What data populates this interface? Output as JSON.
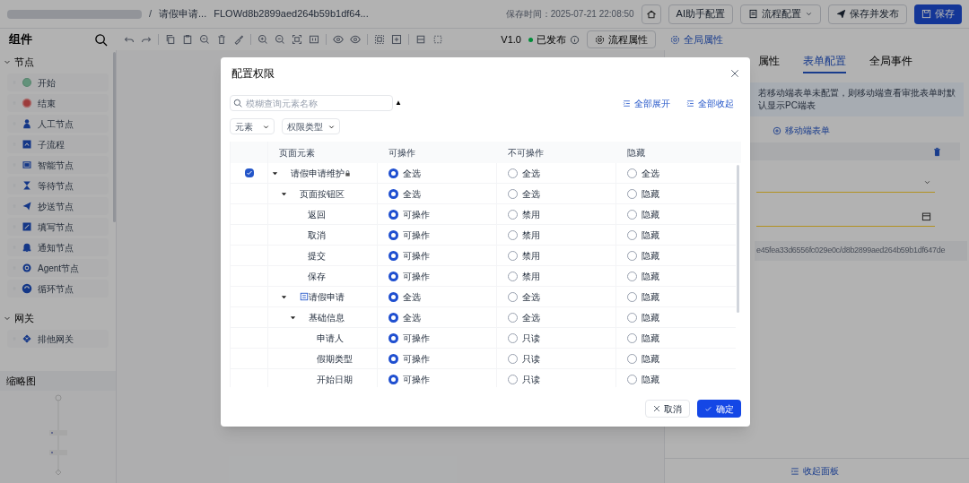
{
  "top_bar": {
    "breadcrumb_separator": "/",
    "process_name": "请假申请...",
    "flow_id": "FLOWd8b2899aed264b59b1df64...",
    "save_time": "保存时间：2025-07-21 22:08:50",
    "buttons": [
      {
        "label": "AI助手配置",
        "kind": "plain"
      },
      {
        "label": "流程配置",
        "kind": "dropdown"
      },
      {
        "label": "保存并发布",
        "kind": "send"
      },
      {
        "label": "保存",
        "kind": "primary"
      }
    ]
  },
  "toolbar": {
    "title": "组件",
    "version": "V1.0",
    "status": "已发布",
    "process_props": "流程属性",
    "global_props": "全局属性"
  },
  "sidebar": {
    "sections": [
      {
        "title": "节点",
        "expanded": true,
        "items": [
          "开始",
          "结束",
          "人工节点",
          "子流程",
          "智能节点",
          "等待节点",
          "抄送节点",
          "填写节点",
          "通知节点",
          "Agent节点",
          "循环节点"
        ]
      },
      {
        "title": "网关",
        "expanded": true,
        "items": [
          "排他网关"
        ]
      }
    ],
    "minimap_title": "缩略图"
  },
  "right_panel": {
    "tabs": [
      {
        "label": "属性",
        "selected": false
      },
      {
        "label": "表单配置",
        "selected": true
      },
      {
        "label": "全局事件",
        "selected": false
      }
    ],
    "notice": "若移动端表单未配置，则移动端查看审批表单时默认显示PC端表",
    "add_link": "移动端表单",
    "url": "e45fea33d6556fc029e0c/d8b2899aed264b59b1df647de",
    "collapse": "收起面板"
  },
  "dialog": {
    "title": "配置权限",
    "search": {
      "placeholder": "模糊查询元素名称"
    },
    "sort_mark": "▲",
    "expand_all": "全部展开",
    "collapse_all": "全部收起",
    "filters": [
      "元素",
      "权限类型"
    ],
    "columns": [
      "页面元素",
      "可操作",
      "不可操作",
      "隐藏"
    ],
    "rows": [
      {
        "name": "请假申请维护",
        "kind": "page",
        "checked": true,
        "expanded": true,
        "options": [
          {
            "label": "全选",
            "selected": true
          },
          {
            "label": "全选",
            "selected": false
          },
          {
            "label": "全选",
            "selected": false
          }
        ],
        "children": [
          {
            "name": "页面按钮区",
            "kind": "group",
            "expanded": true,
            "options": [
              {
                "label": "全选",
                "selected": true
              },
              {
                "label": "全选",
                "selected": false
              },
              {
                "label": "隐藏",
                "selected": false
              }
            ],
            "children": [
              {
                "name": "返回",
                "kind": "item",
                "options": [
                  {
                    "label": "可操作",
                    "selected": true
                  },
                  {
                    "label": "禁用",
                    "selected": false
                  },
                  {
                    "label": "隐藏",
                    "selected": false
                  }
                ]
              },
              {
                "name": "取消",
                "kind": "item",
                "options": [
                  {
                    "label": "可操作",
                    "selected": true
                  },
                  {
                    "label": "禁用",
                    "selected": false
                  },
                  {
                    "label": "隐藏",
                    "selected": false
                  }
                ]
              },
              {
                "name": "提交",
                "kind": "item",
                "options": [
                  {
                    "label": "可操作",
                    "selected": true
                  },
                  {
                    "label": "禁用",
                    "selected": false
                  },
                  {
                    "label": "隐藏",
                    "selected": false
                  }
                ]
              },
              {
                "name": "保存",
                "kind": "item",
                "options": [
                  {
                    "label": "可操作",
                    "selected": true
                  },
                  {
                    "label": "禁用",
                    "selected": false
                  },
                  {
                    "label": "隐藏",
                    "selected": false
                  }
                ]
              }
            ]
          },
          {
            "name": "请假申请",
            "kind": "form",
            "expanded": true,
            "options": [
              {
                "label": "全选",
                "selected": true
              },
              {
                "label": "全选",
                "selected": false
              },
              {
                "label": "隐藏",
                "selected": false
              }
            ],
            "children": [
              {
                "name": "基础信息",
                "kind": "group",
                "expanded": true,
                "options": [
                  {
                    "label": "全选",
                    "selected": true
                  },
                  {
                    "label": "全选",
                    "selected": false
                  },
                  {
                    "label": "隐藏",
                    "selected": false
                  }
                ],
                "children": [
                  {
                    "name": "申请人",
                    "kind": "item",
                    "options": [
                      {
                        "label": "可操作",
                        "selected": true
                      },
                      {
                        "label": "只读",
                        "selected": false
                      },
                      {
                        "label": "隐藏",
                        "selected": false
                      }
                    ]
                  },
                  {
                    "name": "假期类型",
                    "kind": "item",
                    "options": [
                      {
                        "label": "可操作",
                        "selected": true
                      },
                      {
                        "label": "只读",
                        "selected": false
                      },
                      {
                        "label": "隐藏",
                        "selected": false
                      }
                    ]
                  },
                  {
                    "name": "开始日期",
                    "kind": "item",
                    "options": [
                      {
                        "label": "可操作",
                        "selected": true
                      },
                      {
                        "label": "只读",
                        "selected": false
                      },
                      {
                        "label": "隐藏",
                        "selected": false
                      }
                    ]
                  }
                ]
              }
            ]
          }
        ]
      }
    ],
    "buttons": [
      {
        "label": "取消",
        "kind": "cancel"
      },
      {
        "label": "确定",
        "kind": "confirm"
      }
    ]
  }
}
